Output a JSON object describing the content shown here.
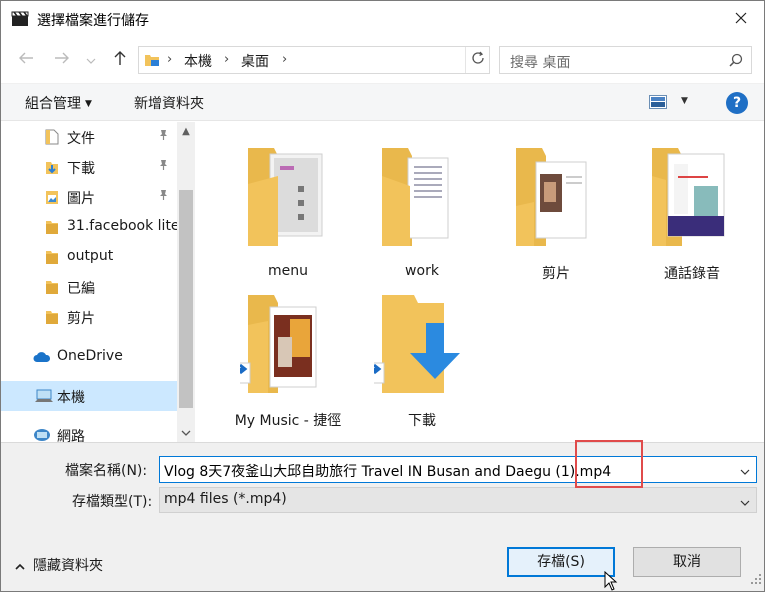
{
  "window": {
    "title": "選擇檔案進行儲存",
    "icons": {
      "app": "clapperboard-icon",
      "close": "close-icon"
    }
  },
  "nav": {
    "back_icon": "arrow-left-icon",
    "forward_icon": "arrow-right-icon",
    "recent_icon": "chevron-down-icon",
    "up_icon": "arrow-up-icon",
    "breadcrumb": [
      "本機",
      "桌面"
    ],
    "refresh_icon": "refresh-icon",
    "search_placeholder": "搜尋 桌面"
  },
  "toolbar": {
    "organize_label": "組合管理",
    "new_folder_label": "新增資料夾",
    "view_icon": "view-options-icon",
    "help_label": "?"
  },
  "sidebar": {
    "items": [
      {
        "label": "文件",
        "icon": "documents-icon",
        "pinned": true
      },
      {
        "label": "下載",
        "icon": "downloads-icon",
        "pinned": true
      },
      {
        "label": "圖片",
        "icon": "pictures-icon",
        "pinned": true
      },
      {
        "label": "31.facebook lite",
        "icon": "folder-icon",
        "pinned": false
      },
      {
        "label": "output",
        "icon": "folder-icon",
        "pinned": false
      },
      {
        "label": "已編",
        "icon": "folder-icon",
        "pinned": false
      },
      {
        "label": "剪片",
        "icon": "folder-icon",
        "pinned": false
      },
      {
        "label": "OneDrive",
        "icon": "cloud-icon",
        "pinned": false
      },
      {
        "label": "本機",
        "icon": "computer-icon",
        "pinned": false,
        "selected": true
      },
      {
        "label": "網路",
        "icon": "network-icon",
        "pinned": false
      }
    ]
  },
  "files": [
    {
      "name": "menu",
      "icon": "folder-icon"
    },
    {
      "name": "work",
      "icon": "folder-icon"
    },
    {
      "name": "剪片",
      "icon": "folder-icon"
    },
    {
      "name": "通話錄音",
      "icon": "folder-icon"
    },
    {
      "name": "My Music - 捷徑",
      "icon": "folder-shortcut-icon"
    },
    {
      "name": "下載",
      "icon": "downloads-shortcut-icon"
    }
  ],
  "form": {
    "filename_label": "檔案名稱(N):",
    "filename_value": "Vlog 8天7夜釜山大邱自助旅行 Travel IN Busan and Daegu (1).mp4",
    "filetype_label": "存檔類型(T):",
    "filetype_value": "mp4 files (*.mp4)",
    "hide_folders_label": "隱藏資料夾",
    "save_label": "存檔(S)",
    "cancel_label": "取消"
  },
  "colors": {
    "accent": "#0078d7",
    "folder": "#f2c35b",
    "highlight_box": "#e04b4b",
    "selected_bg": "#cce8ff"
  }
}
